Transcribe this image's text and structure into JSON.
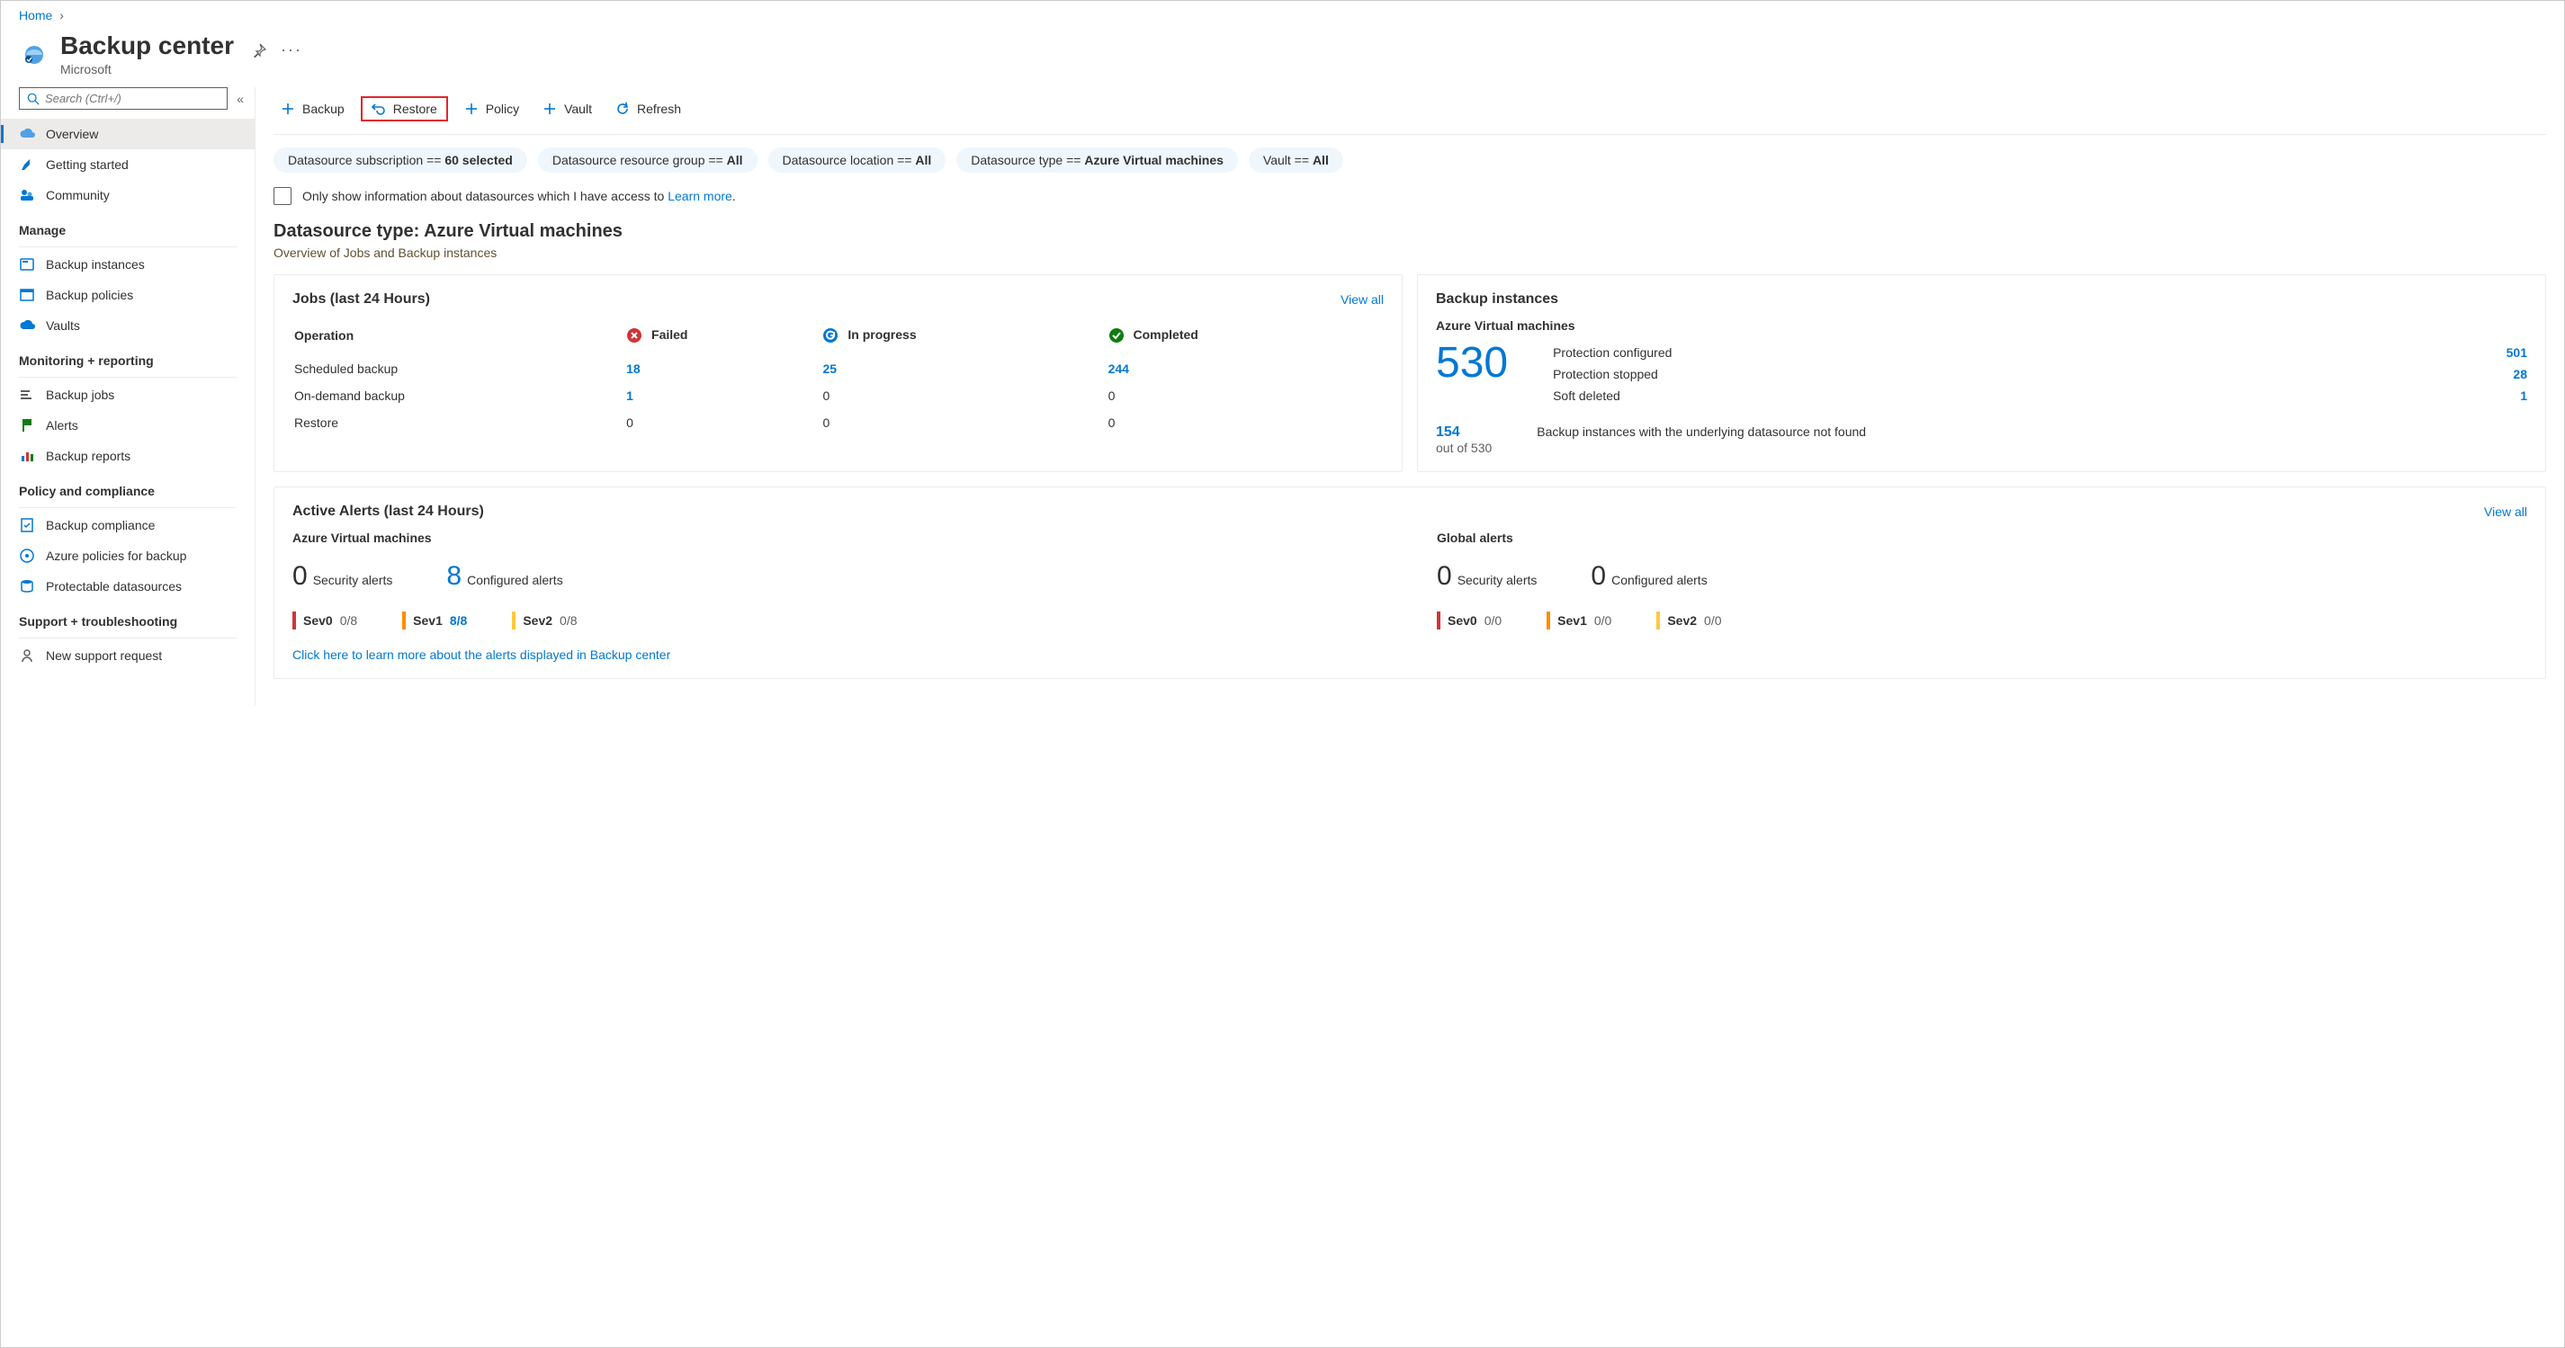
{
  "breadcrumb": {
    "home": "Home"
  },
  "header": {
    "title": "Backup center",
    "subtitle": "Microsoft"
  },
  "search": {
    "placeholder": "Search (Ctrl+/)"
  },
  "sidebar": {
    "top": [
      {
        "label": "Overview",
        "active": true
      },
      {
        "label": "Getting started"
      },
      {
        "label": "Community"
      }
    ],
    "sections": [
      {
        "heading": "Manage",
        "items": [
          {
            "label": "Backup instances"
          },
          {
            "label": "Backup policies"
          },
          {
            "label": "Vaults"
          }
        ]
      },
      {
        "heading": "Monitoring + reporting",
        "items": [
          {
            "label": "Backup jobs"
          },
          {
            "label": "Alerts"
          },
          {
            "label": "Backup reports"
          }
        ]
      },
      {
        "heading": "Policy and compliance",
        "items": [
          {
            "label": "Backup compliance"
          },
          {
            "label": "Azure policies for backup"
          },
          {
            "label": "Protectable datasources"
          }
        ]
      },
      {
        "heading": "Support + troubleshooting",
        "items": [
          {
            "label": "New support request"
          }
        ]
      }
    ]
  },
  "toolbar": {
    "backup": "Backup",
    "restore": "Restore",
    "policy": "Policy",
    "vault": "Vault",
    "refresh": "Refresh"
  },
  "filters": {
    "subscription_label": "Datasource subscription == ",
    "subscription_value": "60 selected",
    "rg_label": "Datasource resource group == ",
    "rg_value": "All",
    "location_label": "Datasource location == ",
    "location_value": "All",
    "type_label": "Datasource type == ",
    "type_value": "Azure Virtual machines",
    "vault_label": "Vault == ",
    "vault_value": "All"
  },
  "access": {
    "text": "Only show information about datasources which I have access to ",
    "link": "Learn more"
  },
  "ds": {
    "title": "Datasource type: Azure Virtual machines",
    "subtitle": "Overview of Jobs and Backup instances"
  },
  "jobs": {
    "title": "Jobs (last 24 Hours)",
    "viewall": "View all",
    "col_operation": "Operation",
    "col_failed": "Failed",
    "col_inprogress": "In progress",
    "col_completed": "Completed",
    "rows": [
      {
        "op": "Scheduled backup",
        "failed": "18",
        "inprogress": "25",
        "completed": "244",
        "link": true
      },
      {
        "op": "On-demand backup",
        "failed": "1",
        "inprogress": "0",
        "completed": "0",
        "link_failed_only": true
      },
      {
        "op": "Restore",
        "failed": "0",
        "inprogress": "0",
        "completed": "0"
      }
    ]
  },
  "instances": {
    "title": "Backup instances",
    "subtitle": "Azure Virtual machines",
    "total": "530",
    "stats": [
      {
        "label": "Protection configured",
        "value": "501"
      },
      {
        "label": "Protection stopped",
        "value": "28"
      },
      {
        "label": "Soft deleted",
        "value": "1"
      }
    ],
    "notfound_num": "154",
    "notfound_of": "out of 530",
    "notfound_desc": "Backup instances with the underlying datasource not found"
  },
  "alerts": {
    "title": "Active Alerts (last 24 Hours)",
    "viewall": "View all",
    "vm": {
      "heading": "Azure Virtual machines",
      "security_n": "0",
      "security_l": "Security alerts",
      "config_n": "8",
      "config_l": "Configured alerts",
      "sev0_l": "Sev0",
      "sev0_v": "0/8",
      "sev1_l": "Sev1",
      "sev1_v": "8/8",
      "sev2_l": "Sev2",
      "sev2_v": "0/8"
    },
    "global": {
      "heading": "Global alerts",
      "security_n": "0",
      "security_l": "Security alerts",
      "config_n": "0",
      "config_l": "Configured alerts",
      "sev0_l": "Sev0",
      "sev0_v": "0/0",
      "sev1_l": "Sev1",
      "sev1_v": "0/0",
      "sev2_l": "Sev2",
      "sev2_v": "0/0"
    },
    "learn": "Click here to learn more about the alerts displayed in Backup center"
  }
}
